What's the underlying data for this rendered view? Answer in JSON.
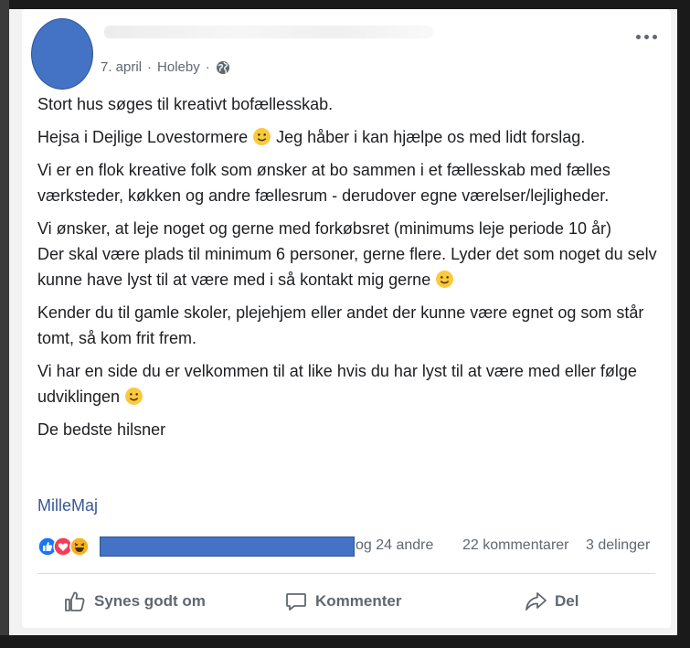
{
  "post": {
    "date": "7. april",
    "separator": "·",
    "location": "Holeby",
    "privacy_icon": "globe-icon",
    "paragraphs": [
      {
        "text": "Stort hus søges til kreativt bofællesskab.",
        "emoji_after": false
      },
      {
        "text": "Hejsa i Dejlige Lovestormere ",
        "emoji_mid": true,
        "text_after": " Jeg håber i kan hjælpe os med lidt forslag."
      },
      {
        "text": "Vi er en flok kreative folk som ønsker at bo sammen i et fællesskab med fælles værksteder, køkken og andre fællesrum - derudover egne værelser/lejligheder.",
        "emoji_after": false
      },
      {
        "text": "Vi ønsker, at leje noget og gerne med forkøbsret (minimums leje periode 10 år)\nDer skal være plads til minimum 6 personer, gerne flere. Lyder det som noget du selv kunne have lyst til at være med i så kontakt mig gerne ",
        "emoji_after": true
      },
      {
        "text": "Kender du til gamle skoler, plejehjem eller andet der kunne være egnet og som står tomt, så kom frit frem.",
        "emoji_after": false
      },
      {
        "text": "Vi har en side du er velkommen til at like hvis du har lyst til at være med eller følge udviklingen ",
        "emoji_after": true
      },
      {
        "text": "De bedste hilsner",
        "emoji_after": false
      }
    ],
    "author_link": "MilleMaj"
  },
  "reactions": {
    "icons": [
      "like-icon",
      "love-icon",
      "haha-icon"
    ],
    "others_text": "og 24 andre",
    "comments_text": "22 kommentarer",
    "shares_text": "3 delinger"
  },
  "actions": {
    "like_label": "Synes godt om",
    "comment_label": "Kommenter",
    "share_label": "Del"
  },
  "colors": {
    "link": "#385898",
    "like_blue": "#1877f2",
    "love_red": "#f33e58",
    "haha_yellow": "#f7b125",
    "redaction_blue": "#4472c4"
  }
}
